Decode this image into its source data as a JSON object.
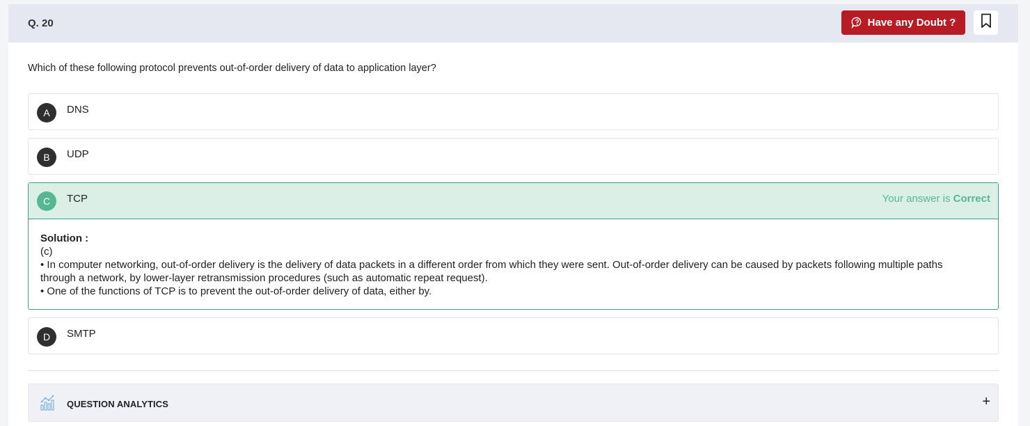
{
  "header": {
    "question_number": "Q. 20",
    "doubt_button_label": "Have any Doubt ?"
  },
  "question": {
    "text": "Which of these following protocol prevents out-of-order delivery of data to application layer?"
  },
  "options": [
    {
      "letter": "A",
      "text": "DNS"
    },
    {
      "letter": "B",
      "text": "UDP"
    },
    {
      "letter": "C",
      "text": "TCP"
    },
    {
      "letter": "D",
      "text": "SMTP"
    }
  ],
  "result": {
    "prefix": "Your answer is ",
    "status": "Correct",
    "accent_color": "#55b893"
  },
  "solution": {
    "title": "Solution :",
    "answer": "(c)",
    "point1": "• In computer networking, out-of-order delivery is the delivery of data packets in a different order from which they were sent. Out-of-order delivery can be caused by packets following multiple paths through a network, by lower-layer retransmission procedures (such as automatic repeat request).",
    "point2": "• One of the functions of TCP is to prevent the out-of-order delivery of data, either by."
  },
  "analytics": {
    "label": "QUESTION ANALYTICS",
    "toggle": "+"
  },
  "colors": {
    "header_bg": "#e6e8f1",
    "doubt_button": "#b71c25",
    "correct_border": "#3fa383",
    "correct_bg": "#dcefe7"
  },
  "icons": {
    "doubt": "chat-question-icon",
    "bookmark": "bookmark-icon",
    "analytics": "bar-chart-icon"
  }
}
